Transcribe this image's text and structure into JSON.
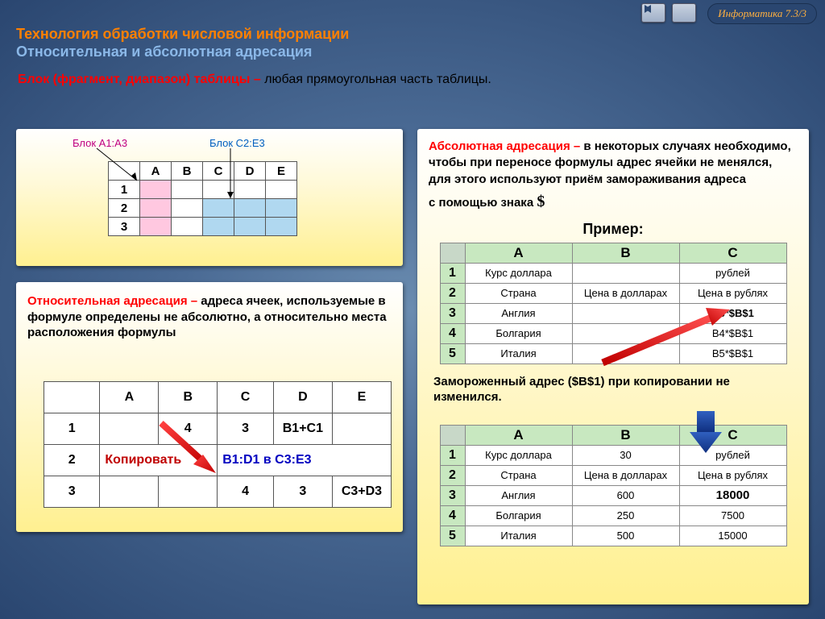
{
  "header": {
    "badge": "Информатика  7.3/3",
    "title1": "Технология обработки числовой информации",
    "title2": "Относительная и абсолютная адресация",
    "def_lead": "Блок (фрагмент, диапазон) таблицы – ",
    "def_rest": "любая прямоугольная часть таблицы."
  },
  "p1": {
    "labelA": "Блок A1:A3",
    "labelC": "Блок C2:E3",
    "cols": [
      "A",
      "B",
      "C",
      "D",
      "E"
    ],
    "rows": [
      "1",
      "2",
      "3"
    ]
  },
  "p2": {
    "lead": "Относительная адресация – ",
    "text": "адреса ячеек, используемые в формуле определены не абсолютно, а относительно места расположения формулы",
    "cols": [
      "A",
      "B",
      "C",
      "D",
      "E"
    ],
    "rows": [
      "1",
      "2",
      "3"
    ],
    "r1": {
      "B": "4",
      "C": "3",
      "D": "B1+C1"
    },
    "r2_copy": "Копировать",
    "r2_range": "B1:D1 в C3:E3",
    "r3": {
      "C": "4",
      "D": "3",
      "E": "C3+D3"
    }
  },
  "p3": {
    "lead": "Абсолютная адресация – ",
    "text1": "в некоторых случаях необходимо, чтобы при переносе формулы адрес ячейки не менялся, для этого используют приём замораживания адреса",
    "text2_pre": "с помощью знака ",
    "dollar": "$",
    "primer": "Пример:",
    "cols": [
      "A",
      "B",
      "C"
    ],
    "rows": [
      "1",
      "2",
      "3",
      "4",
      "5"
    ],
    "tab1": {
      "1": {
        "A": "Курс доллара",
        "B": "",
        "C": "рублей"
      },
      "2": {
        "A": "Страна",
        "B": "Цена в долларах",
        "C": "Цена в рублях"
      },
      "3": {
        "A": "Англия",
        "B": "",
        "C": "B3*$B$1"
      },
      "4": {
        "A": "Болгария",
        "B": "",
        "C": "B4*$B$1"
      },
      "5": {
        "A": "Италия",
        "B": "",
        "C": "B5*$B$1"
      }
    },
    "note": "Замороженный адрес ($B$1) при копировании не изменился.",
    "tab2": {
      "1": {
        "A": "Курс доллара",
        "B": "30",
        "C": "рублей"
      },
      "2": {
        "A": "Страна",
        "B": "Цена в долларах",
        "C": "Цена в рублях"
      },
      "3": {
        "A": "Англия",
        "B": "600",
        "C": "18000"
      },
      "4": {
        "A": "Болгария",
        "B": "250",
        "C": "7500"
      },
      "5": {
        "A": "Италия",
        "B": "500",
        "C": "15000"
      }
    }
  }
}
